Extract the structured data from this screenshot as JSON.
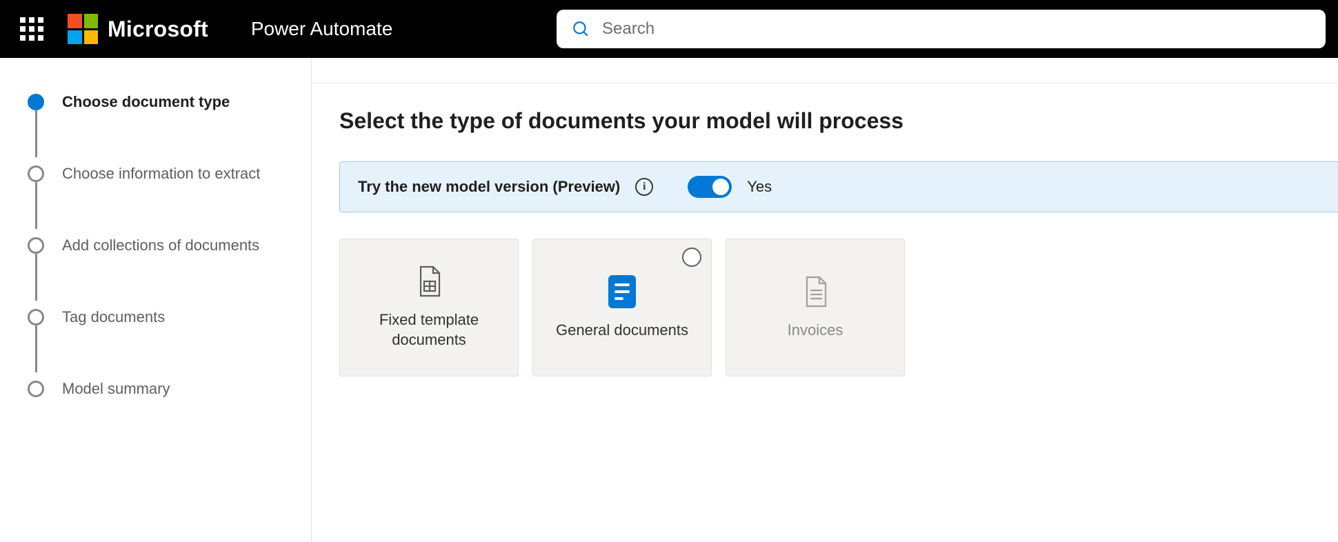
{
  "header": {
    "brand": "Microsoft",
    "product": "Power Automate",
    "search_placeholder": "Search"
  },
  "steps": [
    {
      "label": "Choose document type",
      "active": true
    },
    {
      "label": "Choose information to extract",
      "active": false
    },
    {
      "label": "Add collections of documents",
      "active": false
    },
    {
      "label": "Tag documents",
      "active": false
    },
    {
      "label": "Model summary",
      "active": false
    }
  ],
  "main": {
    "title": "Select the type of documents your model will process",
    "banner": {
      "text": "Try the new model version (Preview)",
      "info_glyph": "i",
      "toggle_on": true,
      "toggle_label": "Yes"
    },
    "cards": [
      {
        "title": "Fixed template documents",
        "icon": "fixed-template",
        "selectable": false,
        "disabled": false
      },
      {
        "title": "General documents",
        "icon": "general",
        "selectable": true,
        "disabled": false
      },
      {
        "title": "Invoices",
        "icon": "invoice",
        "selectable": false,
        "disabled": true
      }
    ]
  }
}
